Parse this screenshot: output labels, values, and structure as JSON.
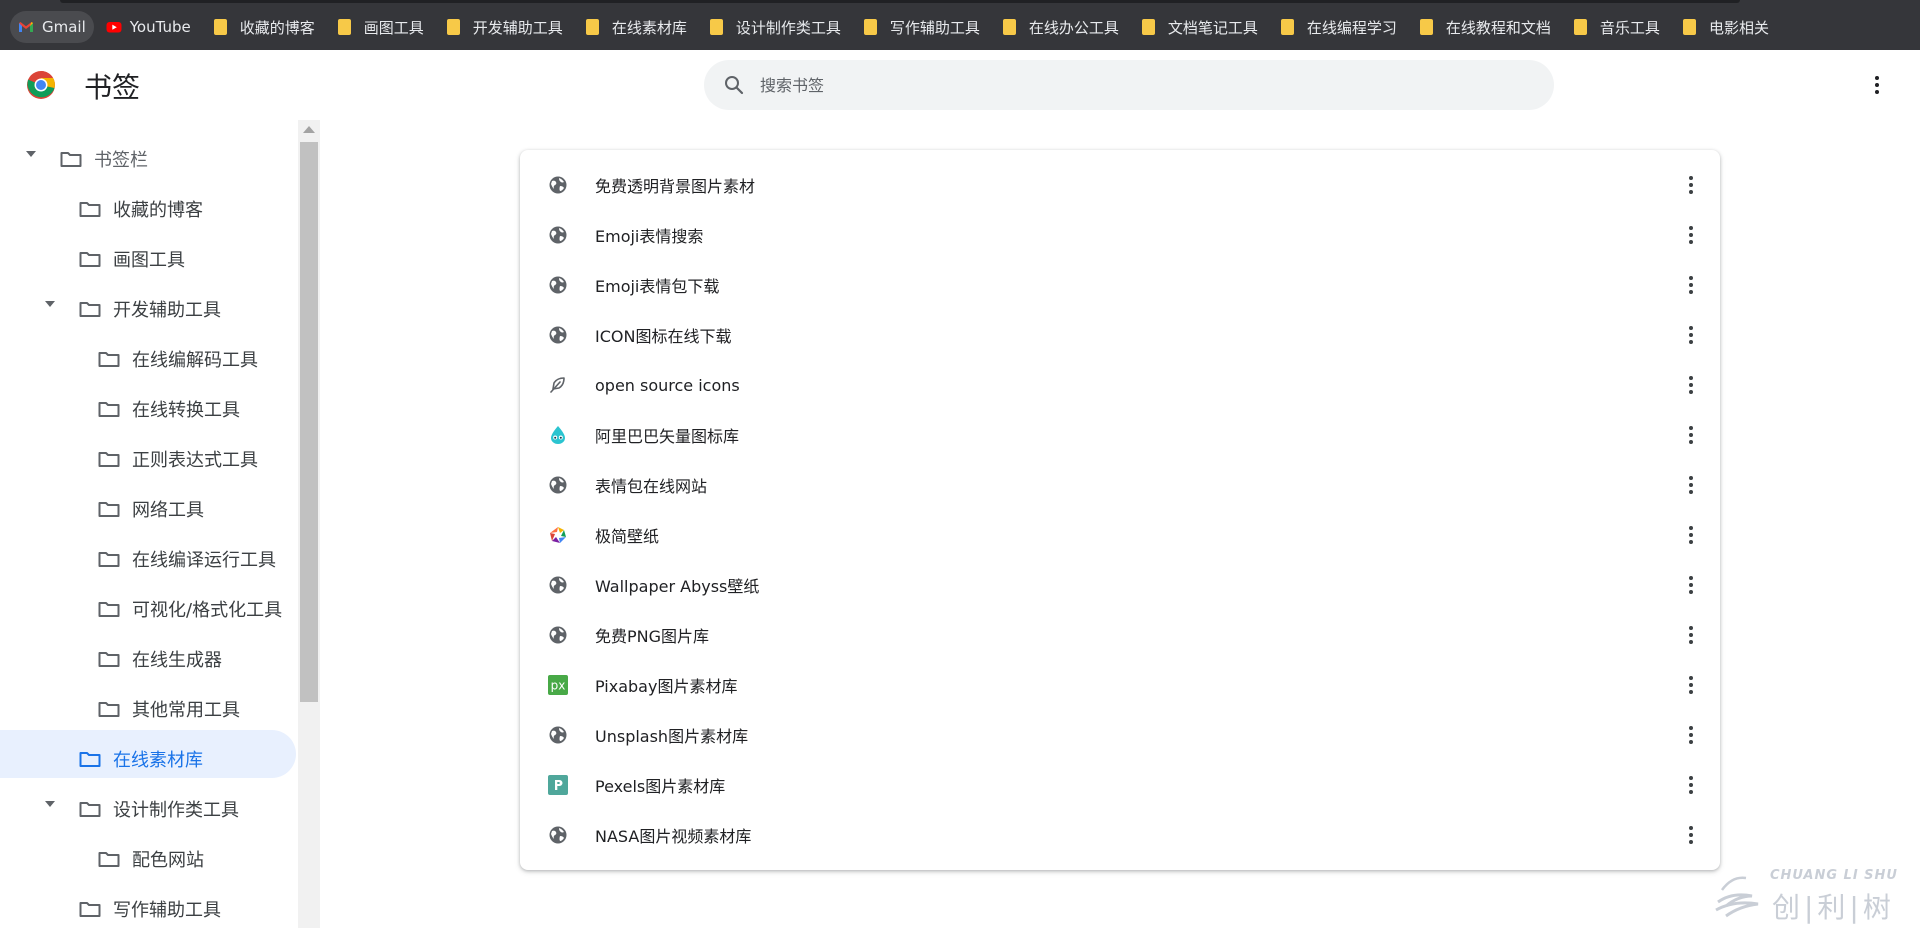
{
  "bookmarks_bar": [
    {
      "label": "Gmail",
      "icon": "gmail-icon",
      "active": true
    },
    {
      "label": "YouTube",
      "icon": "youtube-icon"
    },
    {
      "label": "收藏的博客",
      "icon": "folder-icon"
    },
    {
      "label": "画图工具",
      "icon": "folder-icon"
    },
    {
      "label": "开发辅助工具",
      "icon": "folder-icon"
    },
    {
      "label": "在线素材库",
      "icon": "folder-icon"
    },
    {
      "label": "设计制作类工具",
      "icon": "folder-icon"
    },
    {
      "label": "写作辅助工具",
      "icon": "folder-icon"
    },
    {
      "label": "在线办公工具",
      "icon": "folder-icon"
    },
    {
      "label": "文档笔记工具",
      "icon": "folder-icon"
    },
    {
      "label": "在线编程学习",
      "icon": "folder-icon"
    },
    {
      "label": "在线教程和文档",
      "icon": "folder-icon"
    },
    {
      "label": "音乐工具",
      "icon": "folder-icon"
    },
    {
      "label": "电影相关",
      "icon": "folder-icon"
    }
  ],
  "header": {
    "title": "书签",
    "search_placeholder": "搜索书签"
  },
  "sidebar": {
    "items": [
      {
        "label": "书签栏",
        "expanded": true
      },
      {
        "label": "收藏的博客"
      },
      {
        "label": "画图工具"
      },
      {
        "label": "开发辅助工具",
        "expanded": true
      },
      {
        "label": "在线编解码工具"
      },
      {
        "label": "在线转换工具"
      },
      {
        "label": "正则表达式工具"
      },
      {
        "label": "网络工具"
      },
      {
        "label": "在线编译运行工具"
      },
      {
        "label": "可视化/格式化工具"
      },
      {
        "label": "在线生成器"
      },
      {
        "label": "其他常用工具"
      },
      {
        "label": "在线素材库",
        "selected": true
      },
      {
        "label": "设计制作类工具",
        "expanded": true
      },
      {
        "label": "配色网站"
      },
      {
        "label": "写作辅助工具"
      }
    ]
  },
  "bookmarks": [
    {
      "title": "免费透明背景图片素材",
      "icon": "globe-icon"
    },
    {
      "title": "Emoji表情搜索",
      "icon": "globe-icon"
    },
    {
      "title": "Emoji表情包下载",
      "icon": "globe-icon"
    },
    {
      "title": "ICON图标在线下载",
      "icon": "globe-icon"
    },
    {
      "title": "open source icons",
      "icon": "feather-icon"
    },
    {
      "title": "阿里巴巴矢量图标库",
      "icon": "iconfont-icon"
    },
    {
      "title": "表情包在线网站",
      "icon": "globe-icon"
    },
    {
      "title": "极简壁纸",
      "icon": "colorful-ring-icon"
    },
    {
      "title": "Wallpaper Abyss壁纸",
      "icon": "globe-icon"
    },
    {
      "title": "免费PNG图片库",
      "icon": "globe-icon"
    },
    {
      "title": "Pixabay图片素材库",
      "icon": "pixabay-icon"
    },
    {
      "title": "Unsplash图片素材库",
      "icon": "globe-icon"
    },
    {
      "title": "Pexels图片素材库",
      "icon": "pexels-icon"
    },
    {
      "title": "NASA图片视频素材库",
      "icon": "globe-icon"
    }
  ],
  "watermark": {
    "latin": "CHUANG LI SHU",
    "chinese": "创|利|树"
  },
  "colors": {
    "bookmarks_bar_bg": "#35363a",
    "folder_yellow": "#f7c948",
    "selected_bg": "#e8f0fe",
    "selected_text": "#1a73e8",
    "search_bg": "#f1f3f4"
  }
}
